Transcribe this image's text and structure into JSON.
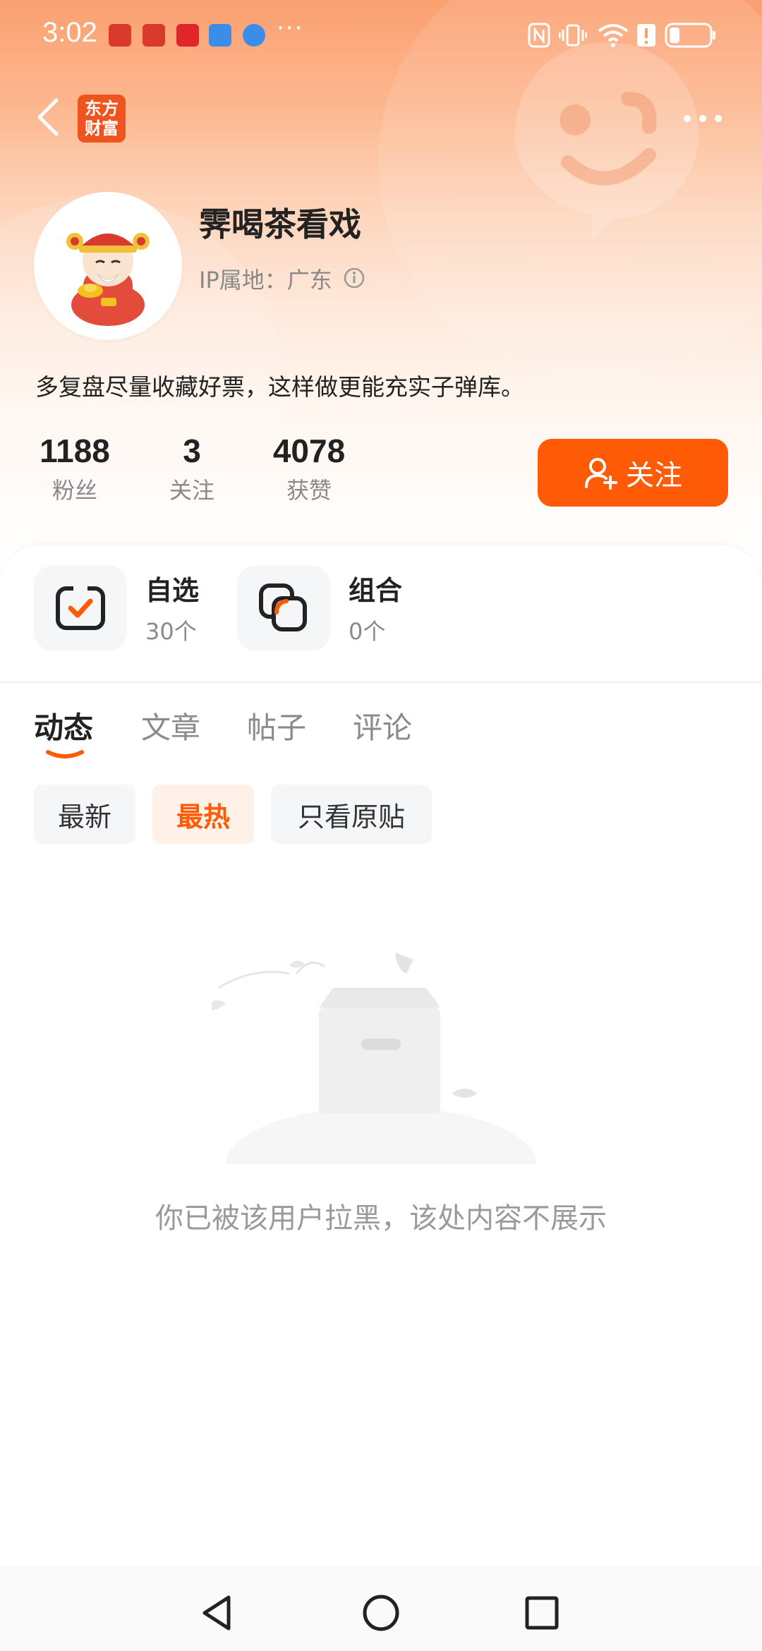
{
  "status_bar": {
    "time": "3:02",
    "app_icon_colors": [
      "#d93a2b",
      "#d93a2b",
      "#e0262b",
      "#3b8de8",
      "#3b8de8"
    ],
    "more_notifications": "···",
    "right_icons": [
      "nfc-icon",
      "vibrate-icon",
      "wifi-icon",
      "alert-icon",
      "battery-icon"
    ]
  },
  "header": {
    "logo_line1": "东方",
    "logo_line2": "财富"
  },
  "profile": {
    "username": "霁喝茶看戏",
    "ip_location": "IP属地：广东",
    "bio": "多复盘尽量收藏好票，这样做更能充实子弹库。"
  },
  "stats": [
    {
      "value": "1188",
      "label": "粉丝"
    },
    {
      "value": "3",
      "label": "关注"
    },
    {
      "value": "4078",
      "label": "获赞"
    }
  ],
  "follow_button": {
    "label": "关注"
  },
  "quick_entries": [
    {
      "title": "自选",
      "sub": "30个",
      "icon": "watchlist-check-icon"
    },
    {
      "title": "组合",
      "sub": "0个",
      "icon": "portfolio-icon"
    }
  ],
  "tabs": [
    {
      "label": "动态",
      "active": true
    },
    {
      "label": "文章",
      "active": false
    },
    {
      "label": "帖子",
      "active": false
    },
    {
      "label": "评论",
      "active": false
    }
  ],
  "filters": [
    {
      "label": "最新",
      "active": false
    },
    {
      "label": "最热",
      "active": true
    },
    {
      "label": "只看原贴",
      "active": false
    }
  ],
  "empty_state": {
    "message": "你已被该用户拉黑，该处内容不展示",
    "icon": "empty-box-icon"
  },
  "nav_bar": {
    "buttons": [
      "back-triangle-icon",
      "home-circle-icon",
      "recents-square-icon"
    ]
  },
  "colors": {
    "accent": "#ff5a06",
    "header_gradient_top": "#fba070",
    "muted_text": "#8a8a8a"
  }
}
